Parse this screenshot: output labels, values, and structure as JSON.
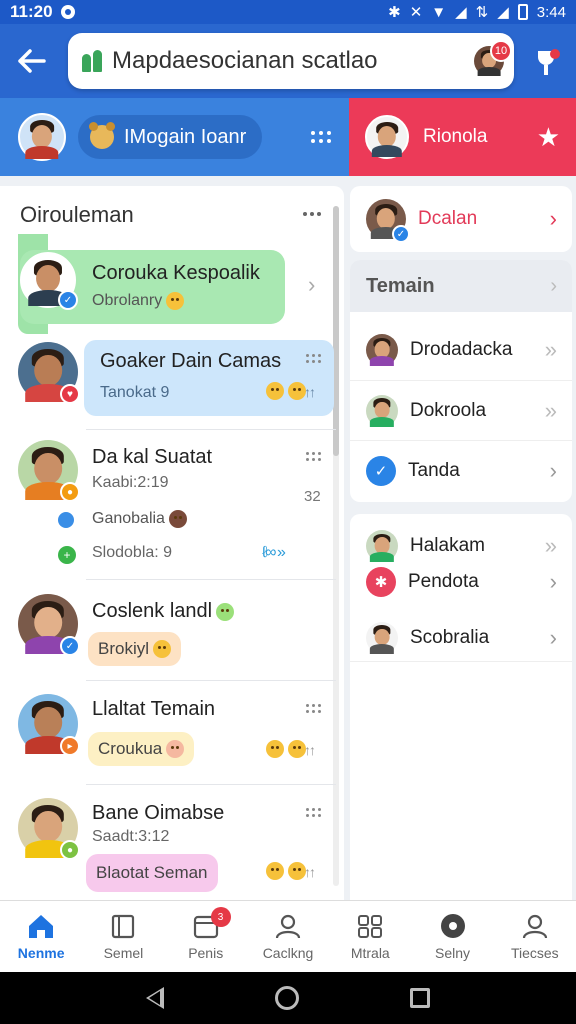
{
  "status_bar": {
    "time": "11:20",
    "right_time": "3:44"
  },
  "app_bar": {
    "search_text": "Mapdaesocianan scatlao",
    "badge": "10"
  },
  "sub_header": {
    "left_pill": "IMogain Ioanr",
    "right_label": "Rionola"
  },
  "left_panel": {
    "title": "Oirouleman",
    "chats": [
      {
        "name": "Corouka Kespoalik",
        "sub": "Obrolanry"
      },
      {
        "name": "Goaker Dain Camas",
        "sub": "Tanokat 9"
      },
      {
        "name": "Da kal Suatat",
        "sub": "Kaabi:2:19",
        "line2": "Ganobalia",
        "line3": "Slodobla: 9",
        "meta": "32"
      },
      {
        "name": "Coslenk landl",
        "sub": "Brokiyl"
      },
      {
        "name": "Llaltat Temain",
        "sub": "Croukua"
      },
      {
        "name": "Bane Oimabse",
        "sub": "Saadt:3:12",
        "line2": "Blaotat Seman"
      }
    ]
  },
  "right_panel": {
    "top_item": "Dcalan",
    "section_title": "Temain",
    "section_items": [
      "Drodadacka",
      "Dokroola",
      "Tanda"
    ],
    "second_items": [
      "Halakam",
      "Pendota",
      "Scobralia"
    ]
  },
  "bottom_nav": {
    "items": [
      "Nenme",
      "Semel",
      "Penis",
      "Caclkng",
      "Mtrala",
      "Selny",
      "Tiecses"
    ],
    "badge": "3"
  },
  "colors": {
    "primary": "#2a67cf",
    "accent": "#ec3a58",
    "active_nav": "#1e73e0"
  }
}
